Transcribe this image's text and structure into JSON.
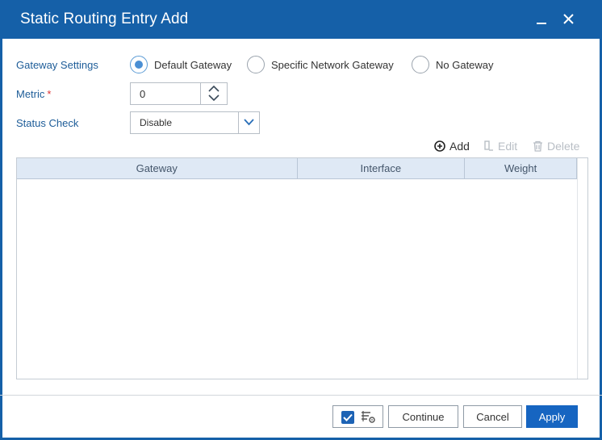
{
  "dialog": {
    "title": "Static Routing Entry Add"
  },
  "form": {
    "gateway_settings_label": "Gateway Settings",
    "gateway_options": [
      {
        "label": "Default Gateway",
        "selected": true
      },
      {
        "label": "Specific Network Gateway",
        "selected": false
      },
      {
        "label": "No Gateway",
        "selected": false
      }
    ],
    "metric_label": "Metric",
    "metric_required_marker": "*",
    "metric_value": "0",
    "status_check_label": "Status Check",
    "status_check_value": "Disable"
  },
  "table_toolbar": {
    "add_label": "Add",
    "edit_label": "Edit",
    "delete_label": "Delete"
  },
  "table": {
    "columns": [
      "Gateway",
      "Interface",
      "Weight"
    ],
    "rows": []
  },
  "footer": {
    "continue_label": "Continue",
    "cancel_label": "Cancel",
    "apply_label": "Apply"
  },
  "colors": {
    "titlebar": "#1560a8",
    "label_text": "#1d5c98",
    "primary_button": "#1665c1",
    "table_header": "#dfe9f5",
    "required_marker": "#dd3333"
  },
  "icons": {
    "minimize": "minimize-icon",
    "close": "close-icon",
    "add": "plus-circle-icon",
    "edit": "edit-icon",
    "delete": "trash-icon",
    "spinner_up": "chevron-up-icon",
    "spinner_down": "chevron-down-icon",
    "select_caret": "chevron-down-icon",
    "option_checkbox": "checkbox-checked-icon",
    "option_settings": "list-settings-icon"
  }
}
